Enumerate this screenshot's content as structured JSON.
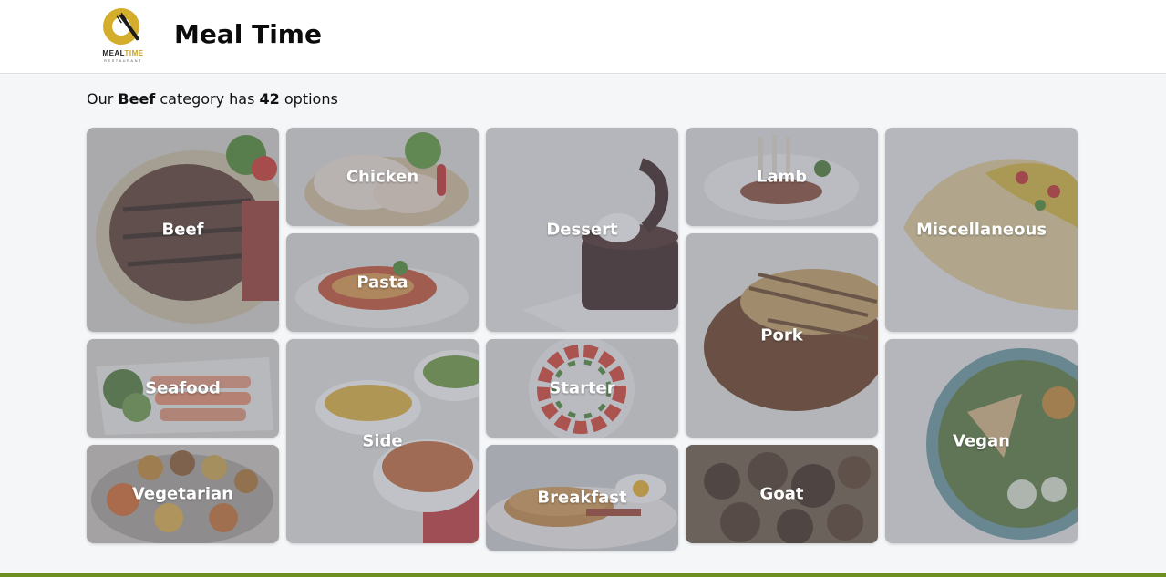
{
  "app": {
    "title": "Meal Time",
    "logo_text_1": "MEAL",
    "logo_text_2": "TIME",
    "logo_sub": "RESTAURANT"
  },
  "summary": {
    "prefix": "Our ",
    "category": "Beef",
    "middle": " category has ",
    "count": "42",
    "suffix": " options"
  },
  "categories": [
    {
      "label": "Beef",
      "icon": "steak"
    },
    {
      "label": "Chicken",
      "icon": "chicken"
    },
    {
      "label": "Dessert",
      "icon": "chocolate-cake"
    },
    {
      "label": "Lamb",
      "icon": "lamb-chops"
    },
    {
      "label": "Miscellaneous",
      "icon": "taco"
    },
    {
      "label": "Pasta",
      "icon": "pasta"
    },
    {
      "label": "Pork",
      "icon": "pork-chop"
    },
    {
      "label": "Seafood",
      "icon": "salmon"
    },
    {
      "label": "Side",
      "icon": "side-bowls"
    },
    {
      "label": "Starter",
      "icon": "caprese"
    },
    {
      "label": "Vegan",
      "icon": "vegan-bowl"
    },
    {
      "label": "Vegetarian",
      "icon": "thali"
    },
    {
      "label": "Breakfast",
      "icon": "pancakes"
    },
    {
      "label": "Goat",
      "icon": "goat-stew"
    }
  ],
  "colors": {
    "brand_gold": "#d3ad2b",
    "footer_green": "#6e8e22",
    "overlay": "#696e7d"
  }
}
